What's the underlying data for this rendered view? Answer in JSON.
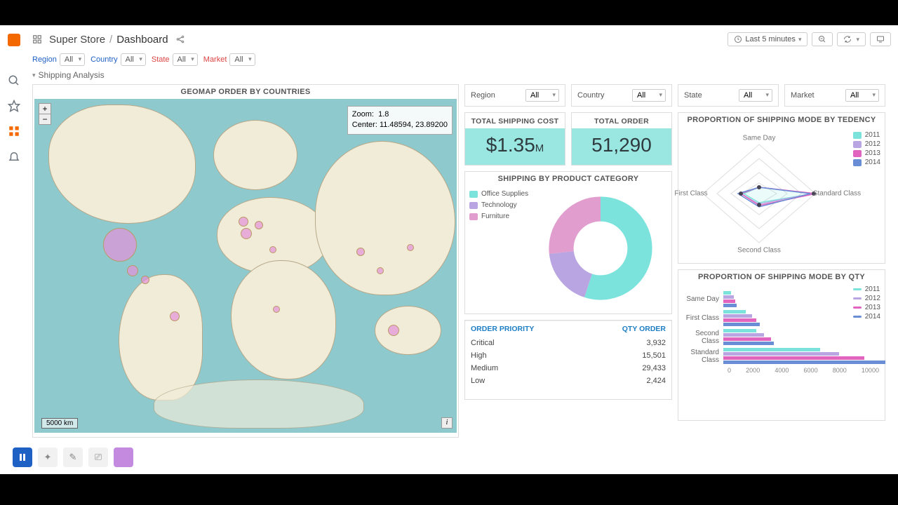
{
  "breadcrumb": {
    "folder": "Super Store",
    "page": "Dashboard"
  },
  "time_picker": "Last 5 minutes",
  "filters": [
    {
      "name": "Region",
      "value": "All"
    },
    {
      "name": "Country",
      "value": "All"
    },
    {
      "name": "State",
      "value": "All"
    },
    {
      "name": "Market",
      "value": "All"
    }
  ],
  "row_title": "Shipping Analysis",
  "map": {
    "title": "GEOMAP ORDER BY COUNTRIES",
    "zoom_label": "Zoom:",
    "zoom": "1.8",
    "center_label": "Center:",
    "center": "11.48594, 23.89200",
    "scale": "5000 km"
  },
  "minifilters": [
    {
      "name": "Region",
      "value": "All"
    },
    {
      "name": "Country",
      "value": "All"
    },
    {
      "name": "State",
      "value": "All"
    },
    {
      "name": "Market",
      "value": "All"
    }
  ],
  "stats": {
    "cost_title": "TOTAL SHIPPING COST",
    "cost_value": "$1.35",
    "cost_unit": "M",
    "order_title": "TOTAL ORDER",
    "order_value": "51,290"
  },
  "donut": {
    "title": "SHIPPING BY PRODUCT CATEGORY",
    "legend": [
      {
        "label": "Office Supplies",
        "color": "#7be3dc"
      },
      {
        "label": "Technology",
        "color": "#b9a5e2"
      },
      {
        "label": "Furniture",
        "color": "#e19dcd"
      }
    ]
  },
  "order_priority": {
    "col1": "ORDER PRIORITY",
    "col2": "QTY ORDER",
    "rows": [
      {
        "label": "Critical",
        "qty": "3,932",
        "pct": 57
      },
      {
        "label": "High",
        "qty": "15,501",
        "pct": 57
      },
      {
        "label": "Medium",
        "qty": "29,433",
        "pct": 57
      },
      {
        "label": "Low",
        "qty": "2,424",
        "pct": 57
      }
    ]
  },
  "radar": {
    "title": "PROPORTION OF SHIPPING MODE BY TEDENCY",
    "axes": [
      "Same Day",
      "Standard Class",
      "Second Class",
      "First Class"
    ],
    "legend": [
      {
        "label": "2011",
        "color": "#7be3dc"
      },
      {
        "label": "2012",
        "color": "#b9a5e2"
      },
      {
        "label": "2013",
        "color": "#e164bf"
      },
      {
        "label": "2014",
        "color": "#6a8ed6"
      }
    ]
  },
  "hbar": {
    "title": "PROPORTION OF SHIPPING MODE BY QTY",
    "legend": [
      {
        "label": "2011",
        "color": "#7be3dc"
      },
      {
        "label": "2012",
        "color": "#b9a5e2"
      },
      {
        "label": "2013",
        "color": "#e164bf"
      },
      {
        "label": "2014",
        "color": "#6a8ed6"
      }
    ],
    "xticks": [
      "0",
      "2000",
      "4000",
      "6000",
      "8000",
      "10000"
    ]
  },
  "chart_data": [
    {
      "type": "pie",
      "title": "SHIPPING BY PRODUCT CATEGORY",
      "series": [
        {
          "name": "Office Supplies",
          "value": 55
        },
        {
          "name": "Technology",
          "value": 18
        },
        {
          "name": "Furniture",
          "value": 27
        }
      ]
    },
    {
      "type": "table",
      "title": "ORDER PRIORITY",
      "categories": [
        "Critical",
        "High",
        "Medium",
        "Low"
      ],
      "values": [
        3932,
        15501,
        29433,
        2424
      ]
    },
    {
      "type": "area",
      "title": "PROPORTION OF SHIPPING MODE BY TEDENCY",
      "categories": [
        "Same Day",
        "Standard Class",
        "Second Class",
        "First Class"
      ],
      "series": [
        {
          "name": "2011",
          "values": [
            0.1,
            0.95,
            0.18,
            0.25
          ]
        },
        {
          "name": "2012",
          "values": [
            0.1,
            0.92,
            0.2,
            0.3
          ]
        },
        {
          "name": "2013",
          "values": [
            0.1,
            0.98,
            0.22,
            0.3
          ]
        },
        {
          "name": "2014",
          "values": [
            0.1,
            0.9,
            0.25,
            0.35
          ]
        }
      ]
    },
    {
      "type": "bar",
      "title": "PROPORTION OF SHIPPING MODE BY QTY",
      "categories": [
        "Same Day",
        "First Class",
        "Second Class",
        "Standard Class"
      ],
      "series": [
        {
          "name": "2011",
          "values": [
            500,
            1400,
            2100,
            6100
          ]
        },
        {
          "name": "2012",
          "values": [
            650,
            1800,
            2550,
            7300
          ]
        },
        {
          "name": "2013",
          "values": [
            750,
            2100,
            3000,
            8900
          ]
        },
        {
          "name": "2014",
          "values": [
            850,
            2300,
            3200,
            10200
          ]
        }
      ],
      "xlim": [
        0,
        10000
      ]
    }
  ]
}
